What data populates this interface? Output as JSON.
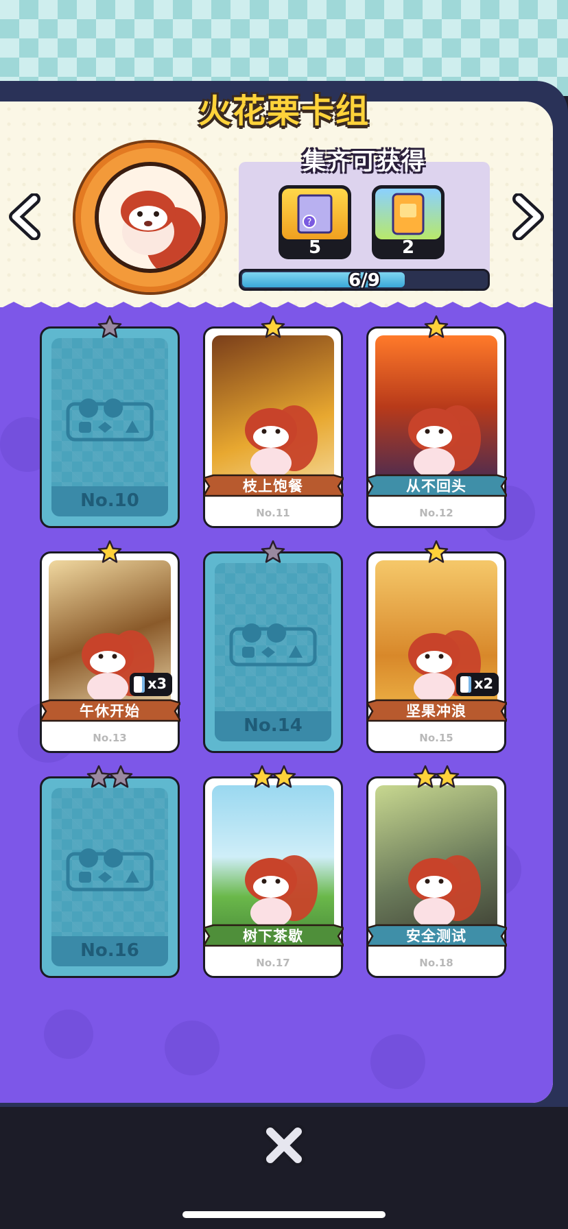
{
  "title": "火花栗卡组",
  "rewards": {
    "heading": "集齐可获得",
    "items": [
      {
        "icon": "mystery-box-icon",
        "count": "5"
      },
      {
        "icon": "card-pack-icon",
        "count": "2"
      }
    ]
  },
  "progress": {
    "text": "6/9",
    "fraction": 0.667
  },
  "cards": [
    {
      "id": "No.10",
      "owned": false,
      "stars": 1,
      "label": ""
    },
    {
      "id": "No.11",
      "owned": true,
      "stars": 1,
      "label": "枝上饱餐"
    },
    {
      "id": "No.12",
      "owned": true,
      "stars": 1,
      "label": "从不回头"
    },
    {
      "id": "No.13",
      "owned": true,
      "stars": 1,
      "label": "午休开始",
      "duplicates": "x3"
    },
    {
      "id": "No.14",
      "owned": false,
      "stars": 1,
      "label": ""
    },
    {
      "id": "No.15",
      "owned": true,
      "stars": 1,
      "label": "坚果冲浪",
      "duplicates": "x2"
    },
    {
      "id": "No.16",
      "owned": false,
      "stars": 2,
      "label": ""
    },
    {
      "id": "No.17",
      "owned": true,
      "stars": 2,
      "label": "树下茶歇"
    },
    {
      "id": "No.18",
      "owned": true,
      "stars": 2,
      "label": "安全测试"
    }
  ],
  "colors": {
    "purple_bg": "#7d57e8",
    "title_yellow": "#ffd33a",
    "locked_card": "#5fb8cf",
    "ribbon_brown": "#b85a2e",
    "ribbon_teal": "#3f8fa8",
    "ribbon_green": "#4f8f3a"
  }
}
